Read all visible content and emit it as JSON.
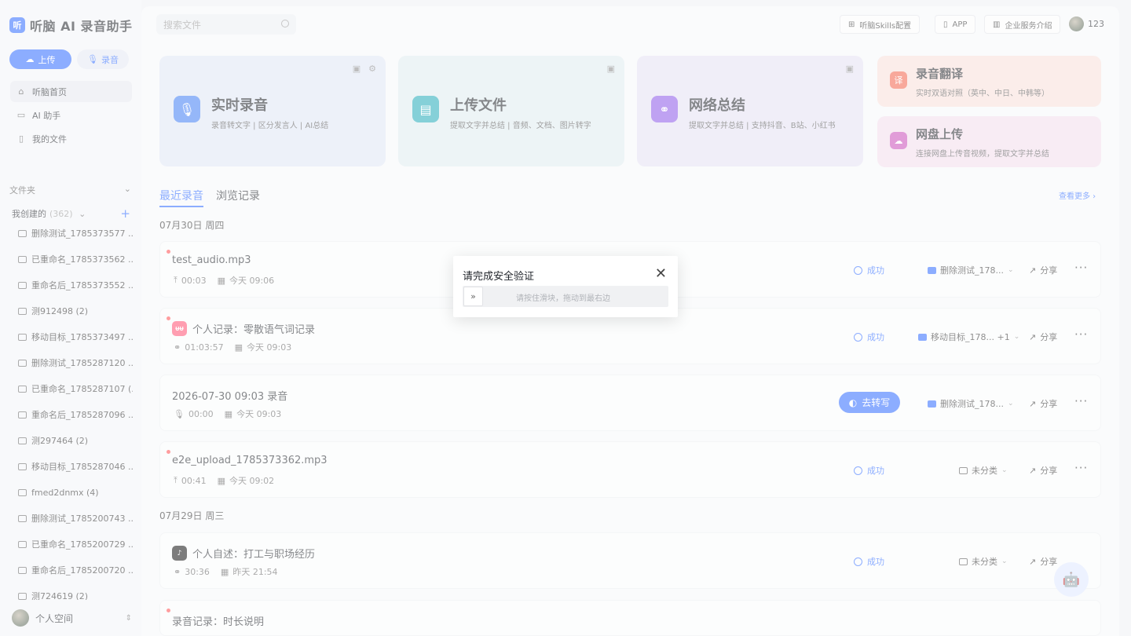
{
  "brand": {
    "logo": "听",
    "name": "听脑 AI 录音助手"
  },
  "sidebar": {
    "upload_label": "上传",
    "record_label": "录音",
    "nav": [
      {
        "label": "听脑首页",
        "icon": "home-icon"
      },
      {
        "label": "AI 助手",
        "icon": "chat-icon"
      },
      {
        "label": "我的文件",
        "icon": "file-icon"
      }
    ],
    "folder_section": "文件夹",
    "mine_label": "我创建的",
    "mine_count": "(362)",
    "folders": [
      "删除测试_1785373577 ...",
      "已重命名_1785373562 ...",
      "重命名后_1785373552 ...",
      "测912498 (2)",
      "移动目标_1785373497 ...",
      "删除测试_1785287120 ...",
      "已重命名_1785287107 (...",
      "重命名后_1785287096 ...",
      "测297464 (2)",
      "移动目标_1785287046 ...",
      "fmed2dnmx (4)",
      "删除测试_1785200743 ...",
      "已重命名_1785200729 ...",
      "重命名后_1785200720 ...",
      "测724619 (2)"
    ],
    "workspace_label": "个人空间"
  },
  "header": {
    "search_placeholder": "搜索文件",
    "skills_label": "听脑Skills配置",
    "app_label": "APP",
    "enterprise_label": "企业服务介绍",
    "user_name": "123"
  },
  "cards": [
    {
      "title": "实时录音",
      "sub": "录音转文字 | 区分发言人 | AI总结",
      "icon": "🎙",
      "color": "#3f7cf5",
      "bg": "#dfe6f5"
    },
    {
      "title": "上传文件",
      "sub": "提取文字并总结 | 音频、文档、图片转字",
      "icon": "▤",
      "color": "#21a9b8",
      "bg": "#deebef"
    },
    {
      "title": "网络总结",
      "sub": "提取文字并总结 | 支持抖音、B站、小红书",
      "icon": "⚭",
      "color": "#8a57e8",
      "bg": "#e4e1f3"
    }
  ],
  "mini_cards": [
    {
      "title": "录音翻译",
      "sub": "实时双语对照（英中、中日、中韩等）",
      "icon": "译",
      "color": "#f2614a",
      "bg": "#f7ded9"
    },
    {
      "title": "网盘上传",
      "sub": "连接网盘上传音视频，提取文字并总结",
      "icon": "☁",
      "color": "#c84bb8",
      "bg": "#f2dcec"
    }
  ],
  "tabs": {
    "recent": "最近录音",
    "history": "浏览记录",
    "more": "查看更多 ›"
  },
  "groups": [
    {
      "date": "07月30日 周四"
    },
    {
      "date": "07月29日 周三"
    }
  ],
  "rows": [
    {
      "title": "test_audio.mp3",
      "duration": "00:03",
      "time": "今天 09:06",
      "status": "成功",
      "folder": "删除测试_178...",
      "share": "分享",
      "dur_icon": "upload-icon"
    },
    {
      "title": "个人记录：零散语气词记录",
      "duration": "01:03:57",
      "time": "今天 09:03",
      "status": "成功",
      "folder": "移动目标_178...  +1",
      "share": "分享",
      "dur_icon": "link-icon",
      "src_badge": "ᵾᵾ"
    },
    {
      "title": "2026-07-30 09:03 录音",
      "duration": "00:00",
      "time": "今天 09:03",
      "convert": "去转写",
      "folder": "删除测试_178...",
      "share": "分享",
      "dur_icon": "mic-icon"
    },
    {
      "title": "e2e_upload_1785373362.mp3",
      "duration": "00:41",
      "time": "今天 09:02",
      "status": "成功",
      "folder": "未分类",
      "share": "分享",
      "dur_icon": "upload-icon"
    },
    {
      "title": "个人自述：打工与职场经历",
      "duration": "30:36",
      "time": "昨天 21:54",
      "status": "成功",
      "folder": "未分类",
      "share": "分享",
      "dur_icon": "link-icon",
      "src_badge": "♪"
    },
    {
      "title": "录音记录：时长说明"
    }
  ],
  "modal": {
    "title": "请完成安全验证",
    "slider_hint": "请按住滑块，拖动到最右边"
  }
}
